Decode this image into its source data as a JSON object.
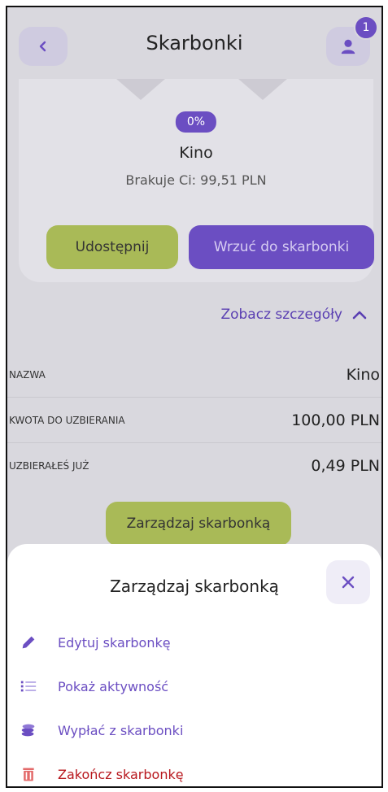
{
  "header": {
    "title": "Skarbonki",
    "notification_count": "1"
  },
  "goal": {
    "progress_label": "0%",
    "progress_fraction": 0.0,
    "name": "Kino",
    "missing_text": "Brakuje Ci: 99,51 PLN"
  },
  "actions": {
    "share_label": "Udostępnij",
    "deposit_label": "Wrzuć do skarbonki",
    "details_label": "Zobacz szczegóły",
    "manage_label": "Zarządzaj skarbonką"
  },
  "details": [
    {
      "label": "NAZWA",
      "value": "Kino"
    },
    {
      "label": "KWOTA DO UZBIERANIA",
      "value": "100,00 PLN"
    },
    {
      "label": "UZBIERAŁEŚ JUŻ",
      "value": "0,49 PLN"
    }
  ],
  "sheet": {
    "title": "Zarządzaj skarbonką",
    "items": [
      {
        "label": "Edytuj skarbonkę",
        "icon": "pencil-icon"
      },
      {
        "label": "Pokaż aktywność",
        "icon": "list-icon"
      },
      {
        "label": "Wypłać z skarbonki",
        "icon": "coins-icon"
      },
      {
        "label": "Zakończ skarbonkę",
        "icon": "trash-icon"
      }
    ]
  },
  "colors": {
    "accent_purple": "#6b4ec2",
    "accent_green": "#a9ba57",
    "danger_red": "#b8181e"
  }
}
